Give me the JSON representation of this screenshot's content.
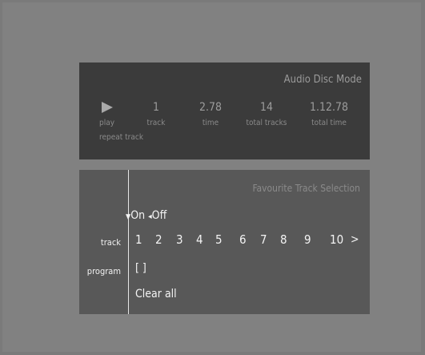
{
  "disc_panel": {
    "title": "Audio Disc Mode",
    "play_label": "play",
    "repeat_label": "repeat track",
    "track_value": "1",
    "track_label": "track",
    "time_value": "2.78",
    "time_label": "time",
    "total_tracks_value": "14",
    "total_tracks_label": "total tracks",
    "total_time_value": "1.12.78",
    "total_time_label": "total time"
  },
  "fav_panel": {
    "title": "Favourite Track Selection",
    "toggle_on": "On",
    "toggle_arrow": "◂",
    "toggle_off": "Off",
    "selector": "▼",
    "track_row_label": "track",
    "program_row_label": "program",
    "tracks": [
      "1",
      "2",
      "3",
      "4",
      "5",
      "6",
      "7",
      "8",
      "9",
      "10"
    ],
    "next": ">",
    "program_slot": "[ ]",
    "clear_all": "Clear all"
  }
}
